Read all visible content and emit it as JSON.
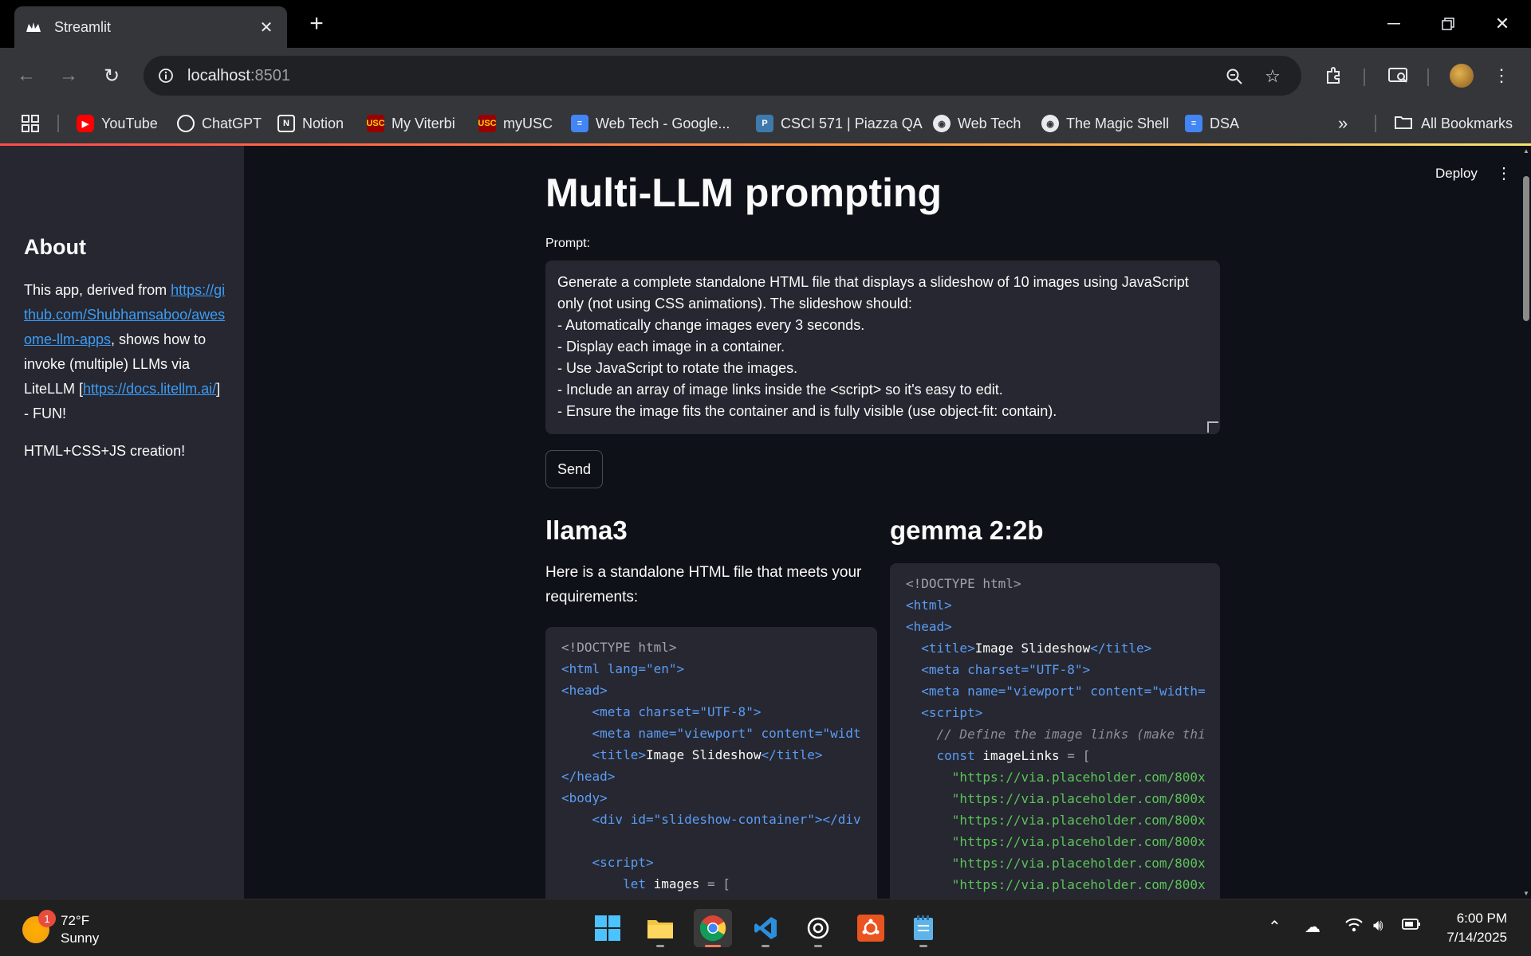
{
  "browser": {
    "tab_title": "Streamlit",
    "new_tab": "+",
    "url_host": "localhost",
    "url_port": ":8501",
    "bookmarks": [
      {
        "label": "YouTube",
        "icon": "youtube-icon",
        "color": "#ff0000"
      },
      {
        "label": "ChatGPT",
        "icon": "chatgpt-icon",
        "color": "#ffffff"
      },
      {
        "label": "Notion",
        "icon": "notion-icon",
        "color": "#ffffff"
      },
      {
        "label": "My Viterbi",
        "icon": "usc-icon",
        "color": "#990000"
      },
      {
        "label": "myUSC",
        "icon": "usc-icon",
        "color": "#990000"
      },
      {
        "label": "Web Tech - Google...",
        "icon": "docs-icon",
        "color": "#4285f4"
      },
      {
        "label": "CSCI 571 | Piazza QA",
        "icon": "piazza-icon",
        "color": "#3e7aab"
      },
      {
        "label": "Web Tech",
        "icon": "globe-icon",
        "color": "#e8eaed"
      },
      {
        "label": "The Magic Shell",
        "icon": "globe-icon",
        "color": "#e8eaed"
      },
      {
        "label": "DSA",
        "icon": "docs-icon",
        "color": "#4285f4"
      }
    ],
    "more_bookmarks": "»",
    "all_bookmarks": "All Bookmarks"
  },
  "sidebar": {
    "title": "About",
    "text_before": "This app, derived from ",
    "link1": "https://github.com/Shubhamsaboo/awesome-llm-apps",
    "text_mid": ", shows how to invoke (multiple) LLMs via LiteLLM [",
    "link2": "https://docs.litellm.ai/",
    "text_after": "] - FUN!",
    "note": "HTML+CSS+JS creation!"
  },
  "header": {
    "deploy": "Deploy",
    "menu": "⋮"
  },
  "main": {
    "title": "Multi-LLM prompting",
    "prompt_label": "Prompt:",
    "prompt_value": "Generate a complete standalone HTML file that displays a slideshow of 10 images using JavaScript only (not using CSS animations). The slideshow should:\n- Automatically change images every 3 seconds.\n- Display each image in a container.\n- Use JavaScript to rotate the images.\n- Include an array of image links inside the <script> so it's easy to edit.\n- Ensure the image fits the container and is fully visible (use object-fit: contain).",
    "send_label": "Send",
    "columns": [
      {
        "model": "llama3",
        "response_text": "Here is a standalone HTML file that meets your requirements:",
        "code": [
          [
            {
              "t": "<!DOCTYPE html>",
              "c": "gray"
            }
          ],
          [
            {
              "t": "<html ",
              "c": "blue"
            },
            {
              "t": "lang=",
              "c": "blue"
            },
            {
              "t": "\"en\"",
              "c": "blue"
            },
            {
              "t": ">",
              "c": "blue"
            }
          ],
          [
            {
              "t": "<head>",
              "c": "blue"
            }
          ],
          [
            {
              "t": "    <meta charset=\"UTF-8\">",
              "c": "blue"
            }
          ],
          [
            {
              "t": "    <meta name=\"viewport\" content=\"widt",
              "c": "blue"
            }
          ],
          [
            {
              "t": "    <title>",
              "c": "blue"
            },
            {
              "t": "Image Slideshow",
              "c": "white"
            },
            {
              "t": "</title>",
              "c": "blue"
            }
          ],
          [
            {
              "t": "</head>",
              "c": "blue"
            }
          ],
          [
            {
              "t": "<body>",
              "c": "blue"
            }
          ],
          [
            {
              "t": "    <div id=\"slideshow-container\"></div",
              "c": "blue"
            }
          ],
          [
            {
              "t": "",
              "c": "white"
            }
          ],
          [
            {
              "t": "    <script>",
              "c": "blue"
            }
          ],
          [
            {
              "t": "        ",
              "c": "white"
            },
            {
              "t": "let",
              "c": "blue"
            },
            {
              "t": " images ",
              "c": "white"
            },
            {
              "t": "= [",
              "c": "gray"
            }
          ]
        ]
      },
      {
        "model": "gemma 2:2b",
        "code": [
          [
            {
              "t": "<!DOCTYPE html>",
              "c": "gray"
            }
          ],
          [
            {
              "t": "<html>",
              "c": "blue"
            }
          ],
          [
            {
              "t": "<head>",
              "c": "blue"
            }
          ],
          [
            {
              "t": "  <title>",
              "c": "blue"
            },
            {
              "t": "Image Slideshow",
              "c": "white"
            },
            {
              "t": "</title>",
              "c": "blue"
            }
          ],
          [
            {
              "t": "  <meta charset=\"UTF-8\">",
              "c": "blue"
            }
          ],
          [
            {
              "t": "  <meta name=\"viewport\" content=\"width=",
              "c": "blue"
            }
          ],
          [
            {
              "t": "  <script>",
              "c": "blue"
            }
          ],
          [
            {
              "t": "    // Define the image links (make thi",
              "c": "comment"
            }
          ],
          [
            {
              "t": "    ",
              "c": "white"
            },
            {
              "t": "const",
              "c": "blue"
            },
            {
              "t": " imageLinks ",
              "c": "white"
            },
            {
              "t": "= [",
              "c": "gray"
            }
          ],
          [
            {
              "t": "      \"https://via.placeholder.com/800x",
              "c": "green"
            }
          ],
          [
            {
              "t": "      \"https://via.placeholder.com/800x",
              "c": "green"
            }
          ],
          [
            {
              "t": "      \"https://via.placeholder.com/800x",
              "c": "green"
            }
          ],
          [
            {
              "t": "      \"https://via.placeholder.com/800x",
              "c": "green"
            }
          ],
          [
            {
              "t": "      \"https://via.placeholder.com/800x",
              "c": "green"
            }
          ],
          [
            {
              "t": "      \"https://via.placeholder.com/800x",
              "c": "green"
            }
          ]
        ]
      }
    ]
  },
  "code_colors": {
    "gray": "#a0a3ad",
    "blue": "#5b9cf5",
    "white": "#fafafa",
    "green": "#5cc45a",
    "comment": "#8b8e99"
  },
  "taskbar": {
    "weather_temp": "72°F",
    "weather_desc": "Sunny",
    "weather_badge": "1",
    "time": "6:00 PM",
    "date": "7/14/2025"
  }
}
